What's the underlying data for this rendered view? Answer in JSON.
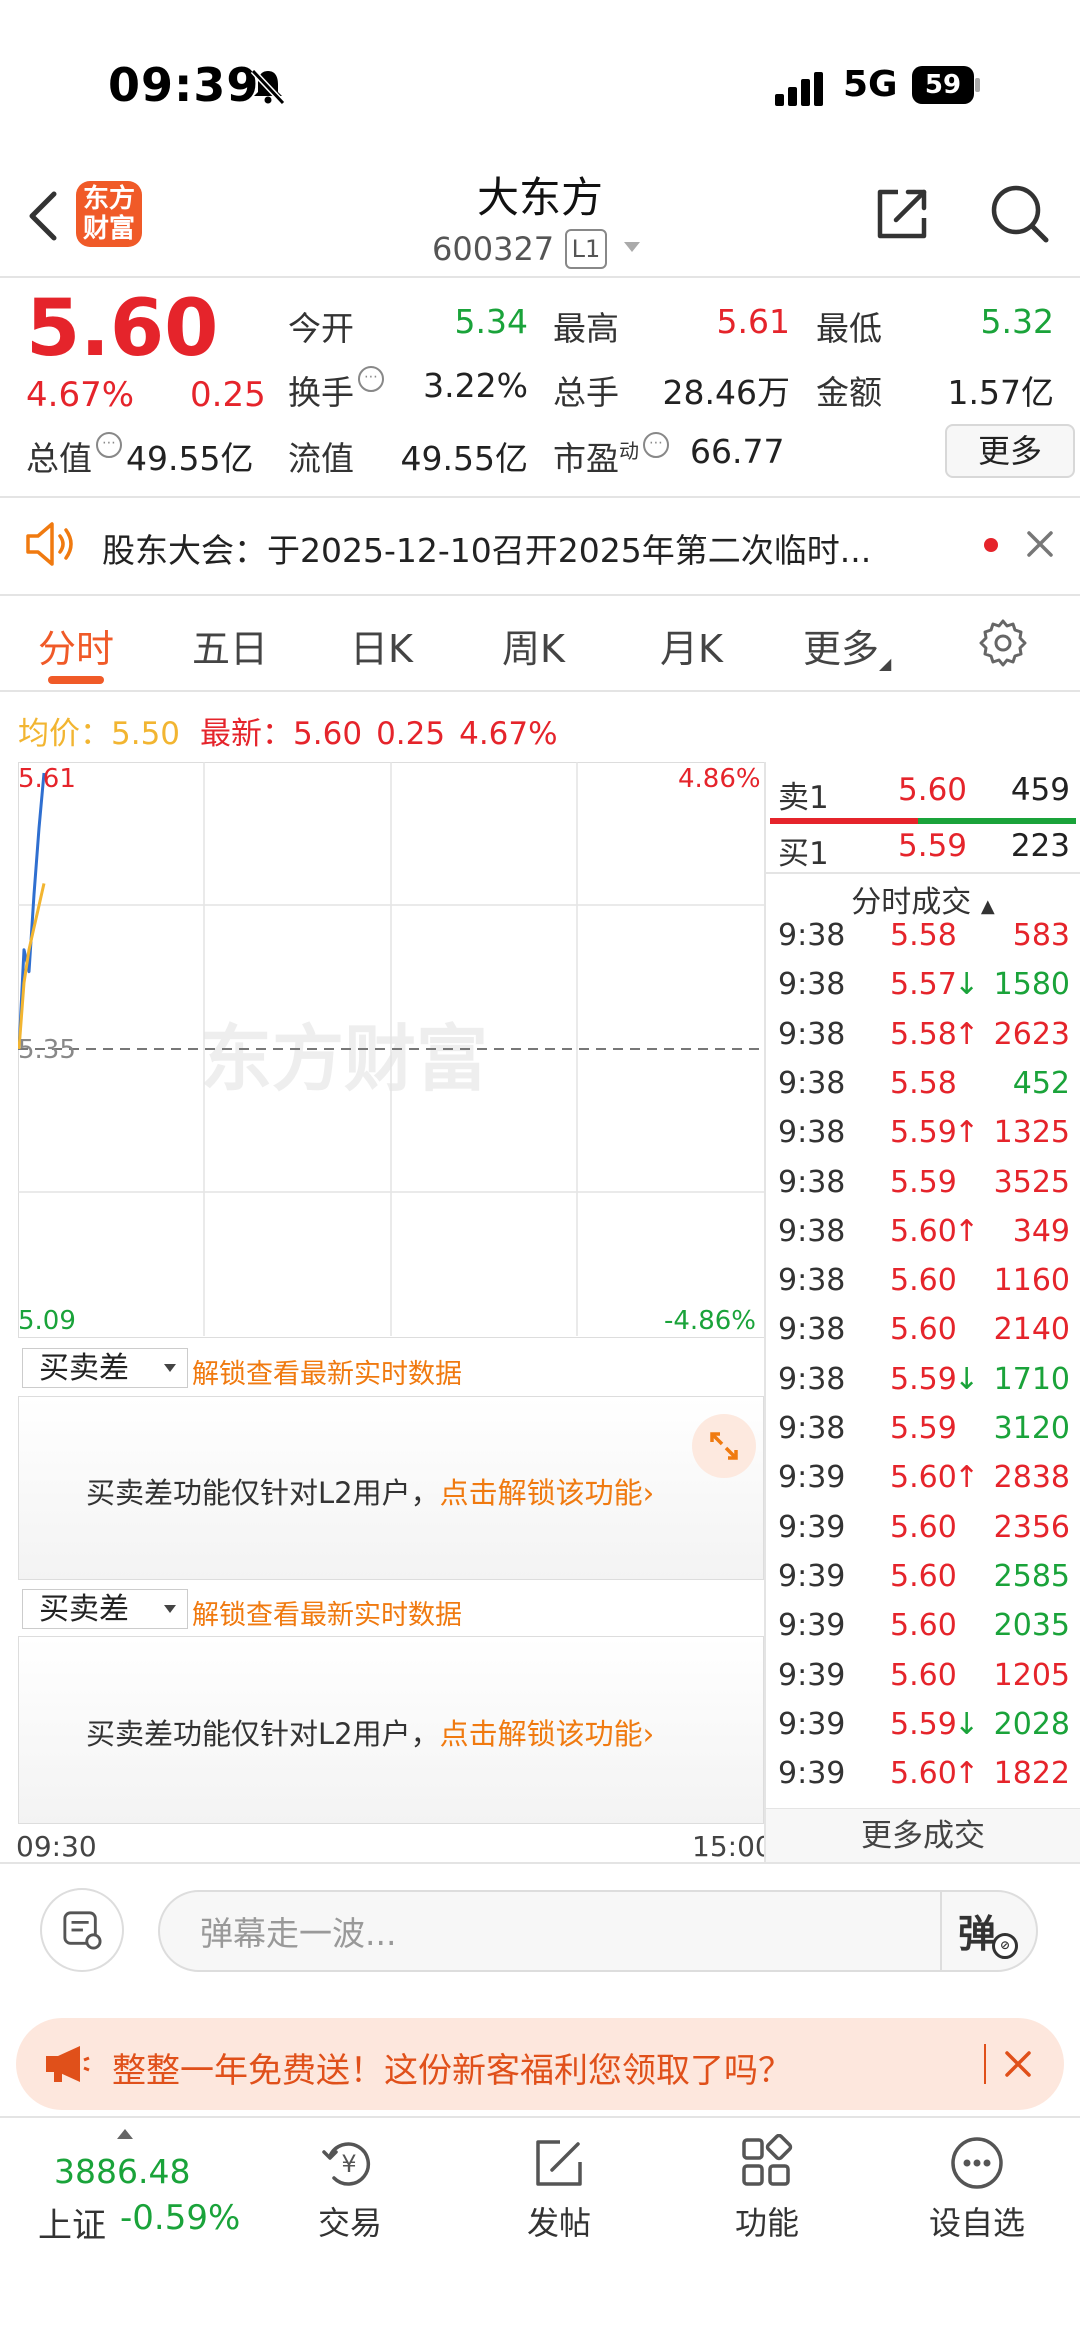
{
  "status_bar": {
    "time": "09:39",
    "network": "5G",
    "battery": "59"
  },
  "header": {
    "logo_line1": "东方",
    "logo_line2": "财富",
    "stock_name": "大东方",
    "stock_code": "600327",
    "level": "L1"
  },
  "quote": {
    "price": "5.60",
    "change_pct": "4.67%",
    "change_amt": "0.25",
    "open_label": "今开",
    "open": "5.34",
    "high_label": "最高",
    "high": "5.61",
    "low_label": "最低",
    "low": "5.32",
    "turnover_label": "换手",
    "turnover": "3.22%",
    "volume_label": "总手",
    "volume": "28.46万",
    "amount_label": "金额",
    "amount": "1.57亿",
    "mktcap_label": "总值",
    "mktcap": "49.55亿",
    "float_label": "流值",
    "float_cap": "49.55亿",
    "pe_label": "市盈",
    "pe_sup": "动",
    "pe": "66.77",
    "more_label": "更多"
  },
  "notice": {
    "text": "股东大会：于2025-12-10召开2025年第二次临时..."
  },
  "tabs": [
    "分时",
    "五日",
    "日K",
    "周K",
    "月K",
    "更多"
  ],
  "avg_row": {
    "avg_label": "均价：",
    "avg": "5.50",
    "latest_label": "最新：",
    "latest": "5.60",
    "chg": "0.25",
    "pct": "4.67%"
  },
  "chart": {
    "y_top": "5.61",
    "y_mid": "5.35",
    "y_bottom": "5.09",
    "pct_top": "4.86%",
    "pct_bottom": "-4.86%",
    "watermark": "东方财富",
    "time_start": "09:30",
    "time_end": "15:00",
    "colors": {
      "price_line": "#2f6fd0",
      "avg_line": "#f2b531"
    }
  },
  "chart_data": {
    "type": "line",
    "ylim": [
      5.09,
      5.61
    ],
    "series": [
      {
        "name": "最新",
        "values": [
          5.35,
          5.44,
          5.42,
          5.49,
          5.55,
          5.6
        ]
      },
      {
        "name": "均价",
        "values": [
          5.35,
          5.41,
          5.44,
          5.46,
          5.48,
          5.5
        ]
      }
    ]
  },
  "sub_panels": [
    {
      "select": "买卖差",
      "unlock": "解锁查看最新实时数据",
      "msg": "买卖差功能仅针对L2用户，",
      "msg_link": "点击解锁该功能"
    },
    {
      "select": "买卖差",
      "unlock": "解锁查看最新实时数据",
      "msg": "买卖差功能仅针对L2用户，",
      "msg_link": "点击解锁该功能"
    }
  ],
  "order_book": {
    "ask_label": "卖1",
    "ask_price": "5.60",
    "ask_vol": "459",
    "bid_label": "买1",
    "bid_price": "5.59",
    "bid_vol": "223"
  },
  "ticks_header": "分时成交",
  "ticks": [
    {
      "time": "9:38",
      "price": "5.58",
      "arrow": "",
      "vol": "583",
      "vol_color": "red"
    },
    {
      "time": "9:38",
      "price": "5.57",
      "arrow": "↓",
      "vol": "1580",
      "vol_color": "green"
    },
    {
      "time": "9:38",
      "price": "5.58",
      "arrow": "↑",
      "vol": "2623",
      "vol_color": "red"
    },
    {
      "time": "9:38",
      "price": "5.58",
      "arrow": "",
      "vol": "452",
      "vol_color": "green"
    },
    {
      "time": "9:38",
      "price": "5.59",
      "arrow": "↑",
      "vol": "1325",
      "vol_color": "red"
    },
    {
      "time": "9:38",
      "price": "5.59",
      "arrow": "",
      "vol": "3525",
      "vol_color": "red"
    },
    {
      "time": "9:38",
      "price": "5.60",
      "arrow": "↑",
      "vol": "349",
      "vol_color": "red"
    },
    {
      "time": "9:38",
      "price": "5.60",
      "arrow": "",
      "vol": "1160",
      "vol_color": "red"
    },
    {
      "time": "9:38",
      "price": "5.60",
      "arrow": "",
      "vol": "2140",
      "vol_color": "red"
    },
    {
      "time": "9:38",
      "price": "5.59",
      "arrow": "↓",
      "vol": "1710",
      "vol_color": "green"
    },
    {
      "time": "9:38",
      "price": "5.59",
      "arrow": "",
      "vol": "3120",
      "vol_color": "green"
    },
    {
      "time": "9:39",
      "price": "5.60",
      "arrow": "↑",
      "vol": "2838",
      "vol_color": "red"
    },
    {
      "time": "9:39",
      "price": "5.60",
      "arrow": "",
      "vol": "2356",
      "vol_color": "red"
    },
    {
      "time": "9:39",
      "price": "5.60",
      "arrow": "",
      "vol": "2585",
      "vol_color": "green"
    },
    {
      "time": "9:39",
      "price": "5.60",
      "arrow": "",
      "vol": "2035",
      "vol_color": "green"
    },
    {
      "time": "9:39",
      "price": "5.60",
      "arrow": "",
      "vol": "1205",
      "vol_color": "red"
    },
    {
      "time": "9:39",
      "price": "5.59",
      "arrow": "↓",
      "vol": "2028",
      "vol_color": "green"
    },
    {
      "time": "9:39",
      "price": "5.60",
      "arrow": "↑",
      "vol": "1822",
      "vol_color": "red"
    }
  ],
  "more_trades": "更多成交",
  "comment": {
    "placeholder": "弹幕走一波...",
    "toggle": "弹"
  },
  "promo": {
    "text": "整整一年免费送！这份新客福利您领取了吗？"
  },
  "bottom_nav": {
    "index_value": "3886.48",
    "index_name": "上证",
    "index_change": "-0.59%",
    "items": [
      {
        "label": "交易",
        "icon": "trade-icon"
      },
      {
        "label": "发帖",
        "icon": "post-icon"
      },
      {
        "label": "功能",
        "icon": "apps-icon"
      },
      {
        "label": "设自选",
        "icon": "more-dots-icon"
      }
    ]
  }
}
